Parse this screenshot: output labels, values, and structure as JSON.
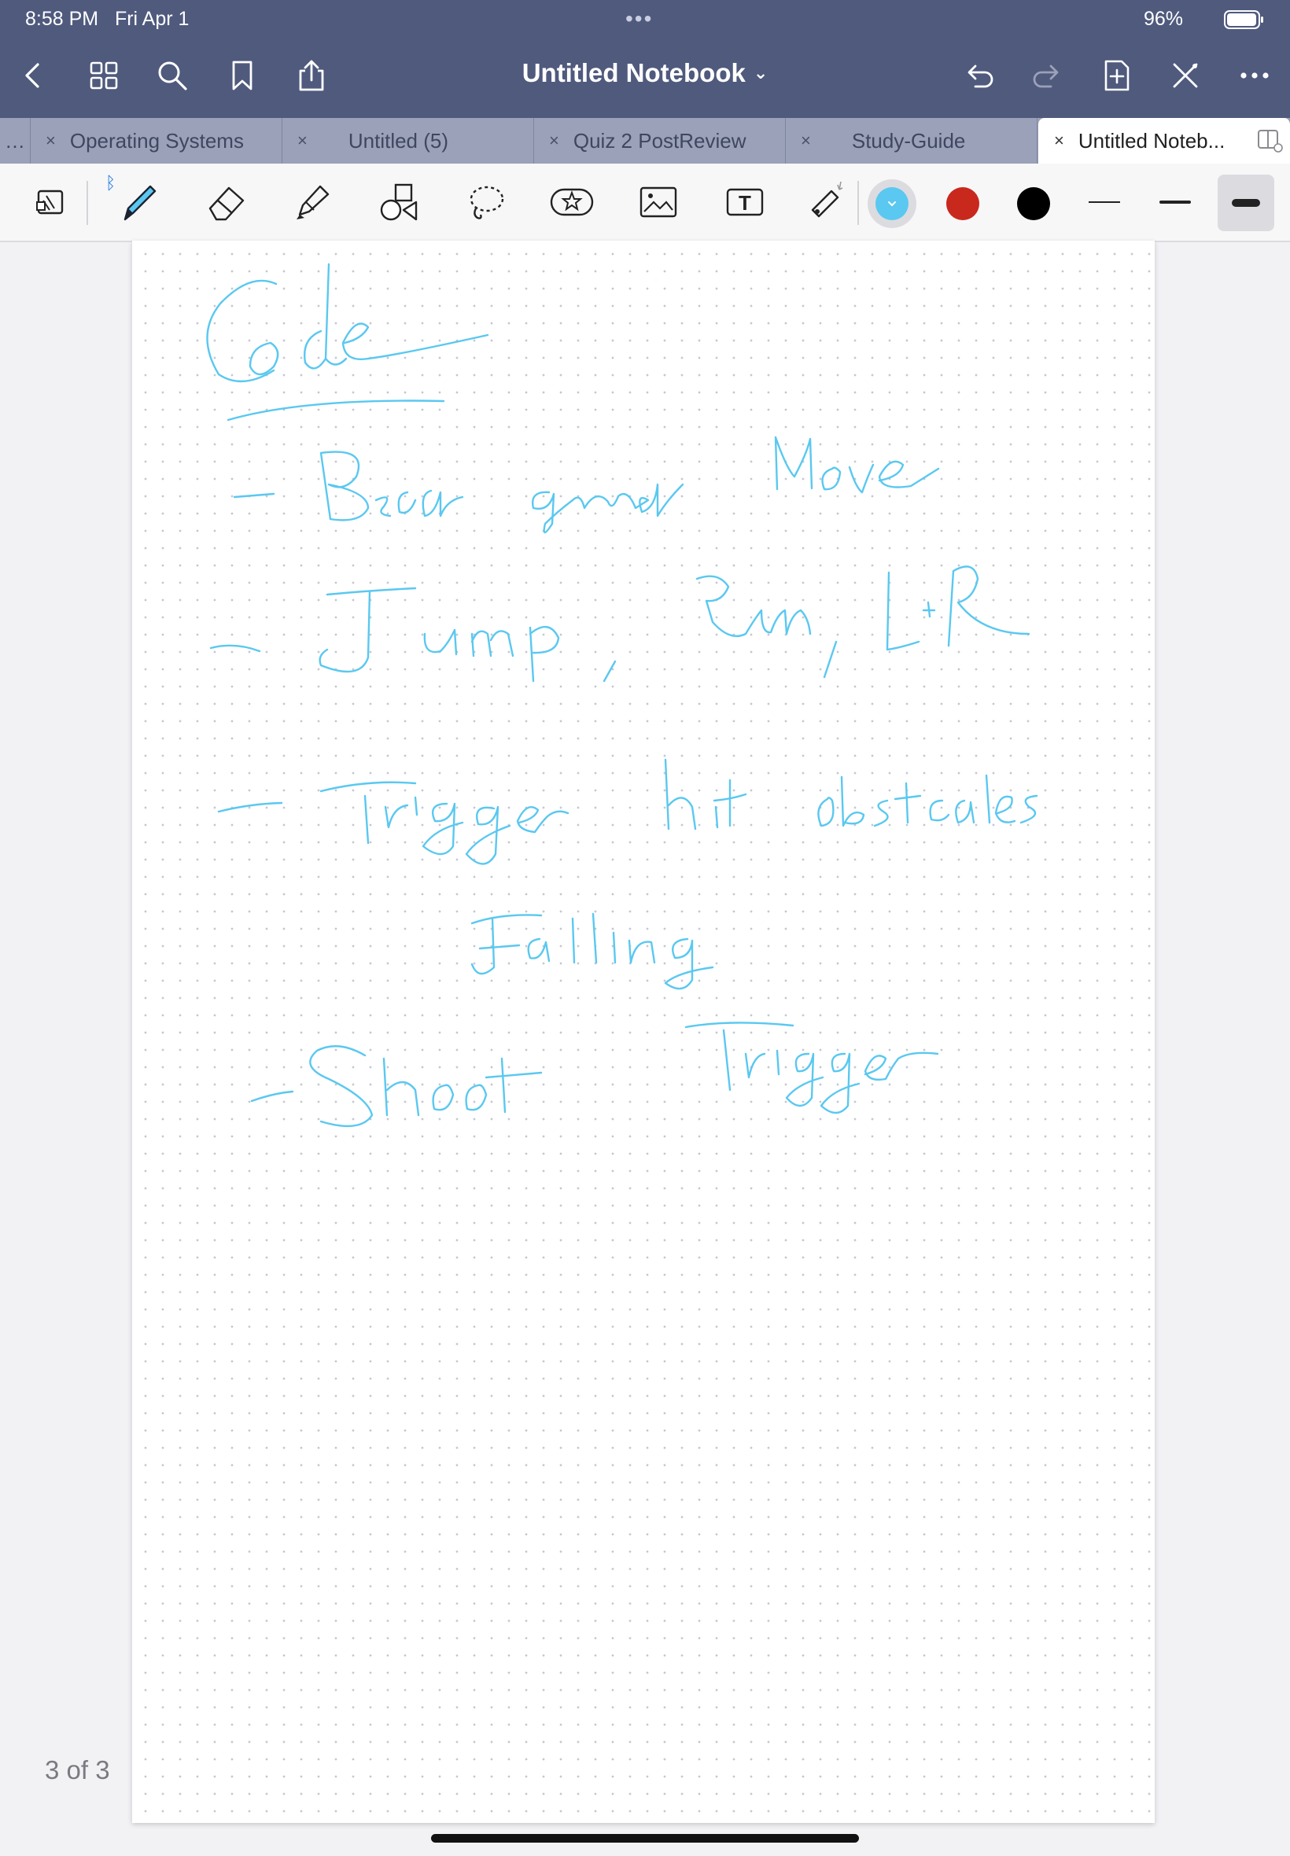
{
  "status": {
    "time": "8:58 PM",
    "date": "Fri Apr 1",
    "dots": "•••",
    "battery": "96%"
  },
  "nav": {
    "title": "Untitled Notebook",
    "title_chevron": "⌄",
    "icons": [
      "back-icon",
      "grid-icon",
      "search-icon",
      "bookmark-icon",
      "share-icon",
      "undo-icon",
      "redo-icon",
      "add-page-icon",
      "close-tools-icon",
      "more-icon"
    ]
  },
  "tabs": [
    {
      "label": "…"
    },
    {
      "label": "Operating Systems",
      "close": "×"
    },
    {
      "label": "Untitled (5)",
      "close": "×"
    },
    {
      "label": "Quiz 2 PostReview",
      "close": "×"
    },
    {
      "label": "Study-Guide",
      "close": "×"
    },
    {
      "label": "Untitled Noteb...",
      "close": "×",
      "active": true
    }
  ],
  "toolbar": {
    "bluetooth_symbol": "ᛒ",
    "colors": {
      "selected": "#5ac8f0",
      "red": "#c9281d",
      "black": "#000000"
    },
    "tools": [
      "read-mode-icon",
      "pen-icon",
      "eraser-icon",
      "highlighter-icon",
      "shapes-icon",
      "lasso-icon",
      "sticker-icon",
      "image-icon",
      "text-icon",
      "laser-pointer-icon"
    ]
  },
  "page": {
    "ink_color": "#5ac8f0",
    "page_count": "3 of 3",
    "handwriting": [
      "Code",
      "Background Move",
      "Jump, Run, L+R",
      "Trigger hit obstacles",
      "Falling",
      "Shoot Trigger"
    ]
  }
}
